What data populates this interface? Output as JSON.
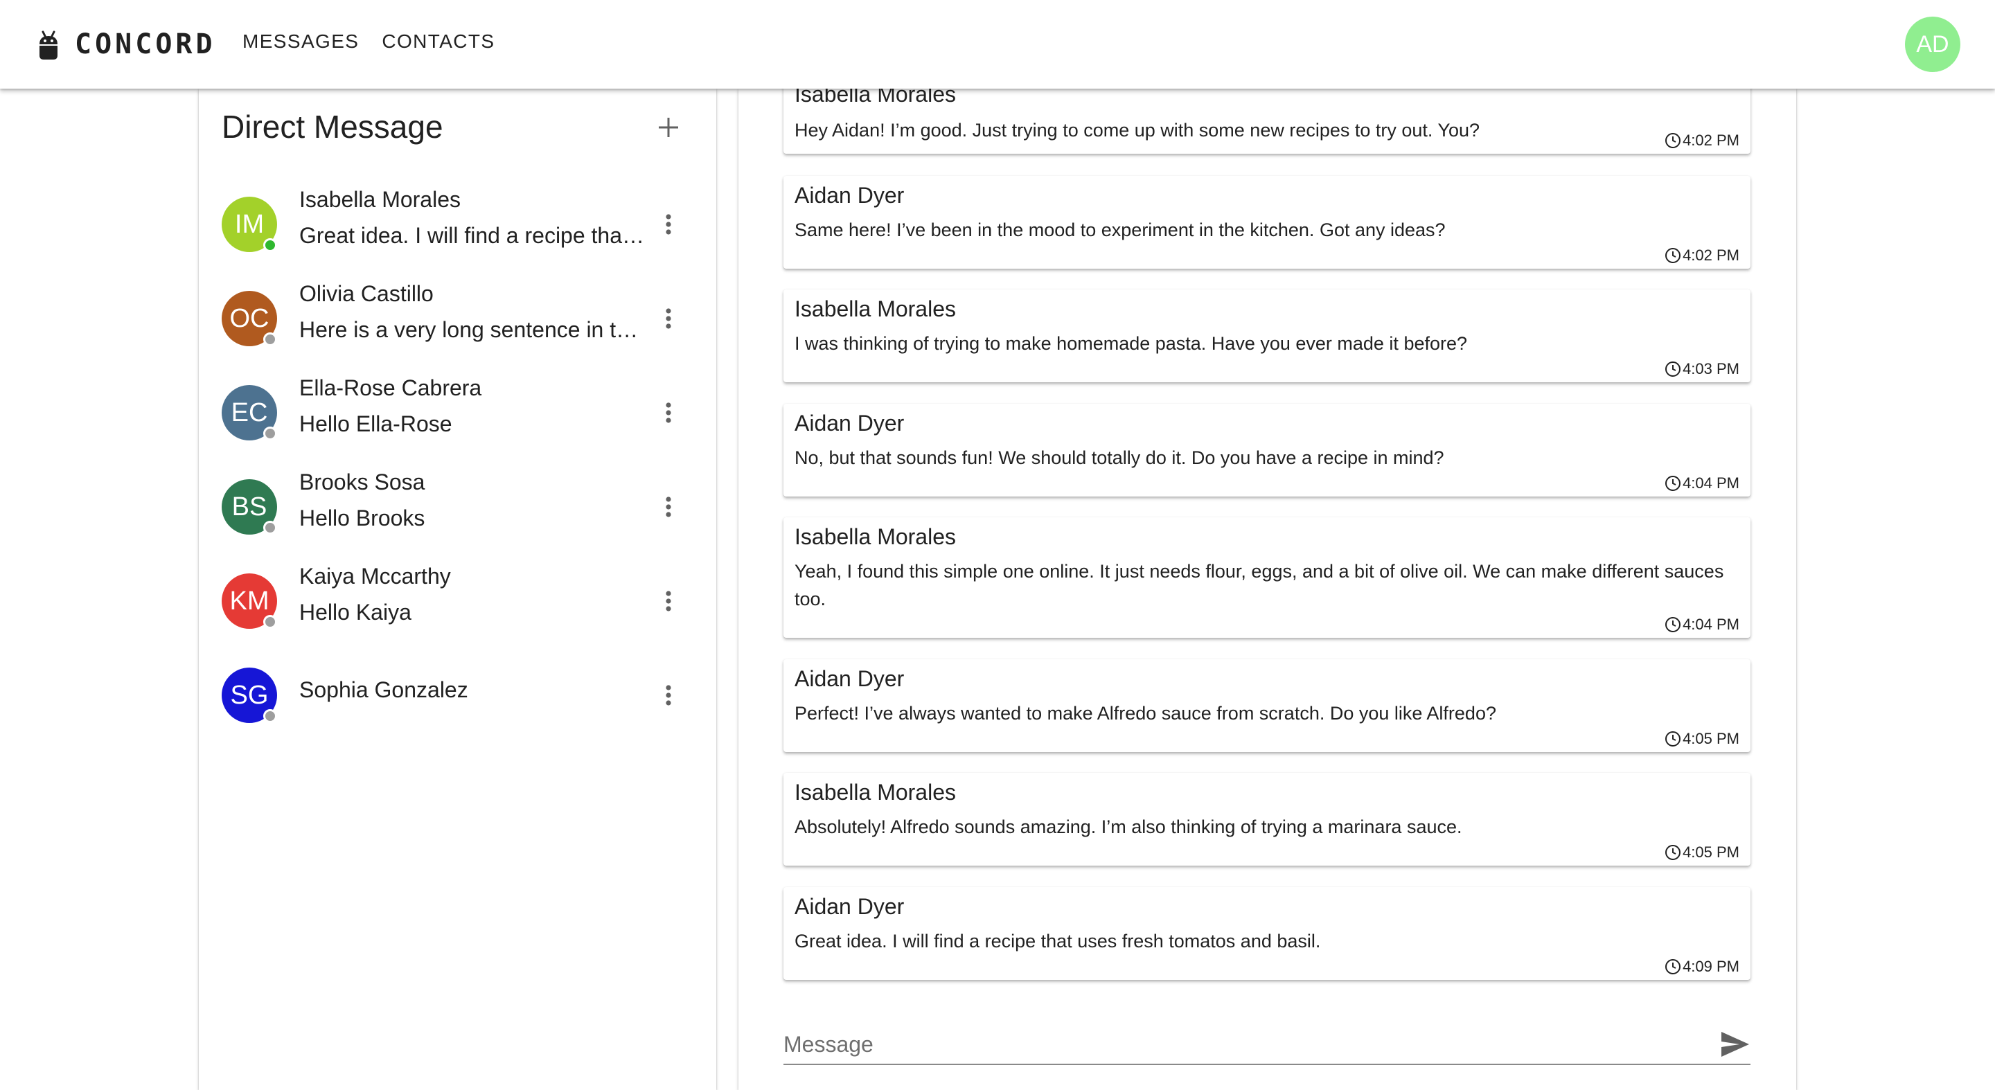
{
  "header": {
    "brand": "CONCORD",
    "nav": [
      "MESSAGES",
      "CONTACTS"
    ],
    "user_initials": "AD",
    "user_avatar_color": "#90ee90"
  },
  "direct_messages": {
    "title": "Direct Message",
    "contacts": [
      {
        "initials": "IM",
        "name": "Isabella Morales",
        "preview": "Great idea. I will find a recipe that uses fresh tomatos and basil.",
        "color": "#a3d12a",
        "status": "online",
        "status_color": "#2fb82f"
      },
      {
        "initials": "OC",
        "name": "Olivia Castillo",
        "preview": "Here is a very long sentence in this message preview",
        "color": "#b05a1f",
        "status": "offline",
        "status_color": "#9e9e9e"
      },
      {
        "initials": "EC",
        "name": "Ella-Rose Cabrera",
        "preview": "Hello Ella-Rose",
        "color": "#4d7290",
        "status": "offline",
        "status_color": "#9e9e9e"
      },
      {
        "initials": "BS",
        "name": "Brooks Sosa",
        "preview": "Hello Brooks",
        "color": "#2f7a52",
        "status": "offline",
        "status_color": "#9e9e9e"
      },
      {
        "initials": "KM",
        "name": "Kaiya Mccarthy",
        "preview": "Hello Kaiya",
        "color": "#e53a35",
        "status": "offline",
        "status_color": "#9e9e9e"
      },
      {
        "initials": "SG",
        "name": "Sophia Gonzalez",
        "preview": "",
        "color": "#1616d6",
        "status": "offline",
        "status_color": "#9e9e9e"
      }
    ]
  },
  "conversation": {
    "messages": [
      {
        "sender": "Isabella Morales",
        "text": "Hey Aidan! I’m good. Just trying to come up with some new recipes to try out. You?",
        "time": "4:02 PM"
      },
      {
        "sender": "Aidan Dyer",
        "text": "Same here! I’ve been in the mood to experiment in the kitchen. Got any ideas?",
        "time": "4:02 PM"
      },
      {
        "sender": "Isabella Morales",
        "text": "I was thinking of trying to make homemade pasta. Have you ever made it before?",
        "time": "4:03 PM"
      },
      {
        "sender": "Aidan Dyer",
        "text": "No, but that sounds fun! We should totally do it. Do you have a recipe in mind?",
        "time": "4:04 PM"
      },
      {
        "sender": "Isabella Morales",
        "text": "Yeah, I found this simple one online. It just needs flour, eggs, and a bit of olive oil. We can make different sauces too.",
        "time": "4:04 PM"
      },
      {
        "sender": "Aidan Dyer",
        "text": "Perfect! I’ve always wanted to make Alfredo sauce from scratch. Do you like Alfredo?",
        "time": "4:05 PM"
      },
      {
        "sender": "Isabella Morales",
        "text": "Absolutely! Alfredo sounds amazing. I’m also thinking of trying a marinara sauce.",
        "time": "4:05 PM"
      },
      {
        "sender": "Aidan Dyer",
        "text": "Great idea. I will find a recipe that uses fresh tomatos and basil.",
        "time": "4:09 PM"
      }
    ],
    "composer_placeholder": "Message"
  }
}
